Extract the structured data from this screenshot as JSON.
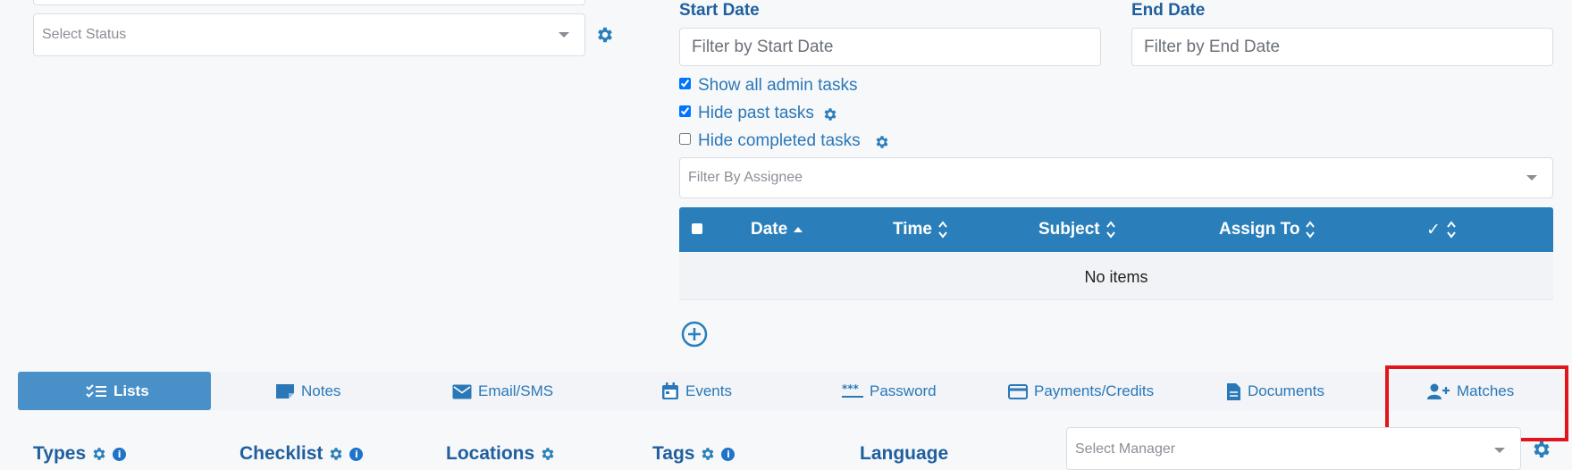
{
  "status_filter": {
    "placeholder": "Select Status",
    "gear_icon": "gear-icon"
  },
  "dates": {
    "start_label": "Start Date",
    "start_placeholder": "Filter by Start Date",
    "end_label": "End Date",
    "end_placeholder": "Filter by End Date"
  },
  "options": {
    "show_admin": {
      "label": "Show all admin tasks",
      "checked": true
    },
    "hide_past": {
      "label": "Hide past tasks",
      "checked": true
    },
    "hide_completed": {
      "label": "Hide completed tasks",
      "checked": false
    }
  },
  "assignee_filter": {
    "placeholder": "Filter By Assignee"
  },
  "table": {
    "columns": [
      "Date",
      "Time",
      "Subject",
      "Assign To",
      "✓"
    ],
    "empty_text": "No items"
  },
  "tabs": [
    {
      "label": "Lists",
      "icon": "checklist-icon",
      "active": true
    },
    {
      "label": "Notes",
      "icon": "note-icon",
      "active": false
    },
    {
      "label": "Email/SMS",
      "icon": "envelope-icon",
      "active": false
    },
    {
      "label": "Events",
      "icon": "calendar-icon",
      "active": false
    },
    {
      "label": "Password",
      "icon": "password-icon",
      "active": false
    },
    {
      "label": "Payments/Credits",
      "icon": "credit-card-icon",
      "active": false
    },
    {
      "label": "Documents",
      "icon": "document-icon",
      "active": false
    },
    {
      "label": "Matches",
      "icon": "user-plus-icon",
      "active": false,
      "highlighted": true
    }
  ],
  "sections": {
    "types": "Types",
    "checklist": "Checklist",
    "locations": "Locations",
    "tags": "Tags",
    "language": "Language"
  },
  "manager_filter": {
    "placeholder": "Select Manager"
  },
  "colors": {
    "primary": "#2a7fbb",
    "active_tab": "#4a90c8",
    "label": "#1f5f9e",
    "link": "#2a78b8",
    "highlight": "#e0161c"
  }
}
